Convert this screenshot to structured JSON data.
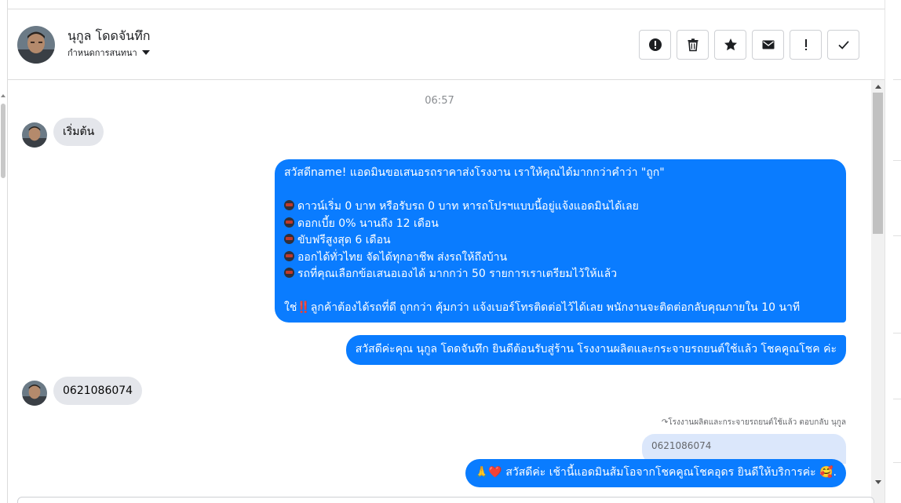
{
  "header": {
    "contact_name": "นุกูล โดดจันทึก",
    "assign_label": "กำหนดการสนทนา"
  },
  "actions": [
    {
      "name": "report-button",
      "icon": "alert-circle-icon"
    },
    {
      "name": "delete-button",
      "icon": "trash-icon"
    },
    {
      "name": "star-button",
      "icon": "star-icon"
    },
    {
      "name": "mark-unread-button",
      "icon": "envelope-icon"
    },
    {
      "name": "priority-button",
      "icon": "exclamation-icon"
    },
    {
      "name": "done-button",
      "icon": "check-icon"
    }
  ],
  "chat": {
    "timestamp": "06:57",
    "msg_start": "เริ่มต้น",
    "offer": {
      "intro": "สวัสดีname! แอดมินขอเสนอรถราคาส่งโรงงาน เราให้คุณได้มากกว่าคำว่า \"ถูก\"",
      "bullets": [
        "ดาวน์เริ่ม 0 บาท หรือรับรถ 0 บาท หารถโปรฯแบบนี้อยู่แจ้งแอดมินได้เลย",
        "ดอกเบี้ย 0% นานถึง 12 เดือน",
        "ขับฟรีสูงสุด 6 เดือน",
        "ออกได้ทั่วไทย จัดได้ทุกอาชีพ ส่งรถให้ถึงบ้าน",
        "รถที่คุณเลือกข้อเสนอเองได้ มากกว่า 50 รายการเราเตรียมไว้ให้แล้ว"
      ],
      "closing_prefix": "ใช่",
      "closing_mark": "‼️",
      "closing_text": "ลูกค้าต้องได้รถที่ดี ถูกกว่า คุ้มกว่า แจ้งเบอร์โทรติดต่อไว้ได้เลย พนักงานจะติดต่อกลับคุณภายใน 10 นาที"
    },
    "greeting": "สวัสดีค่ะคุณ นุกูล โดดจันทึก ยินดีต้อนรับสู่ร้าน โรงงานผลิตและกระจายรถยนต์ใช้แล้ว โชคคูณโชค ค่ะ",
    "phone": "0621086074",
    "reply_caption": "↷โรงงานผลิตและกระจายรถยนต์ใช้แล้ว ตอบกลับ นุกูล",
    "reply_quote": "0621086074",
    "last_reply": {
      "prefix": "🙏❤️",
      "text": "สวัสดีค่ะ เช้านี้แอดมินส้มโอจากโชคคูณโชคอุดร ยินดีให้บริการค่ะ",
      "suffix": "🥰."
    }
  }
}
